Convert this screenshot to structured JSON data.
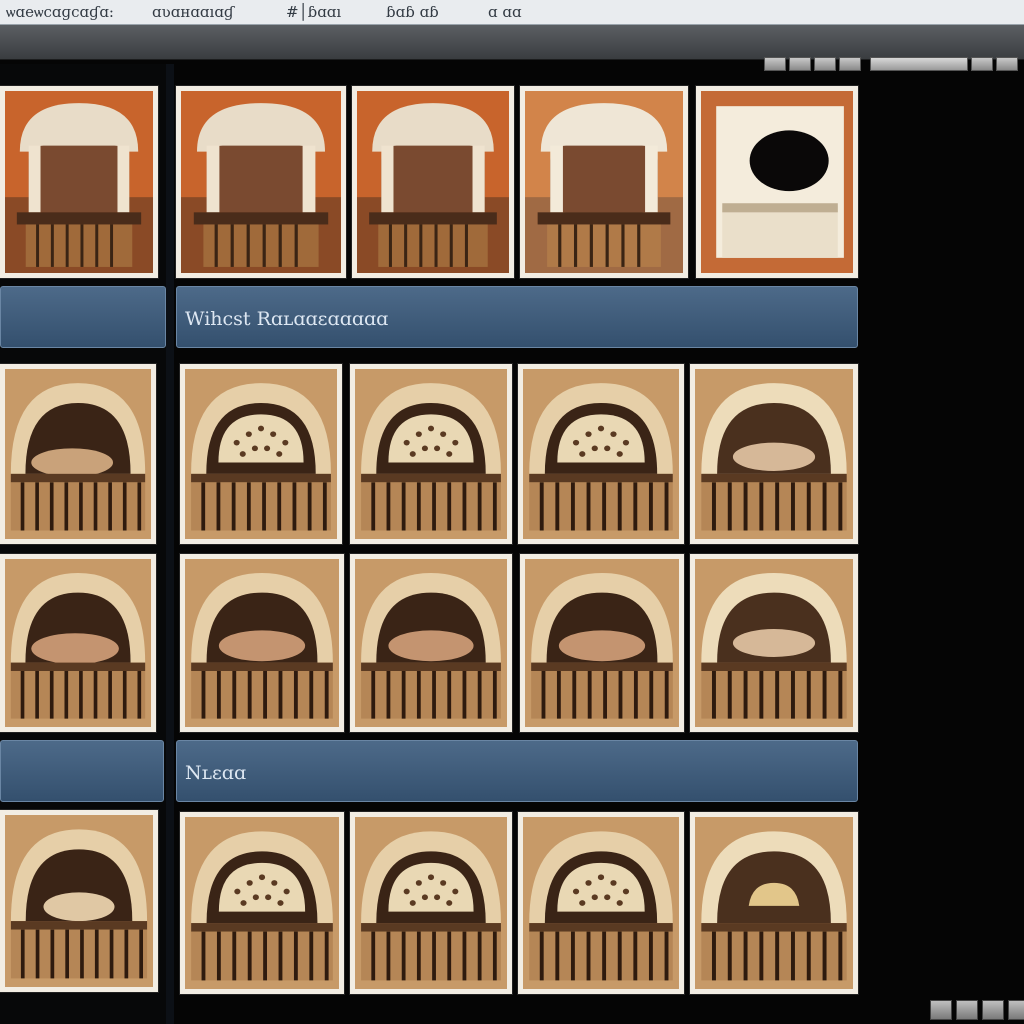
{
  "window": {
    "title_segments": [
      "ѡɑеѡсɑɡcɑɠɑ:",
      "ɑʋɑнɑɑıɑɠ",
      "#│ɓɑɑı",
      "ɓɑɓ ɑɓ",
      "ɑ ɑɑ"
    ]
  },
  "sections": [
    {
      "label": ""
    },
    {
      "label": "Wihcst Rɑʟɑɑɛɑɑɑɑɑ"
    },
    {
      "label": "Nʟɛɑɑ"
    }
  ],
  "thumbnail_icon": "oven-photo-icon",
  "colors": {
    "section_bar": "#3e5b7a",
    "thumb_border": "#f2ede3",
    "background": "#050505"
  }
}
